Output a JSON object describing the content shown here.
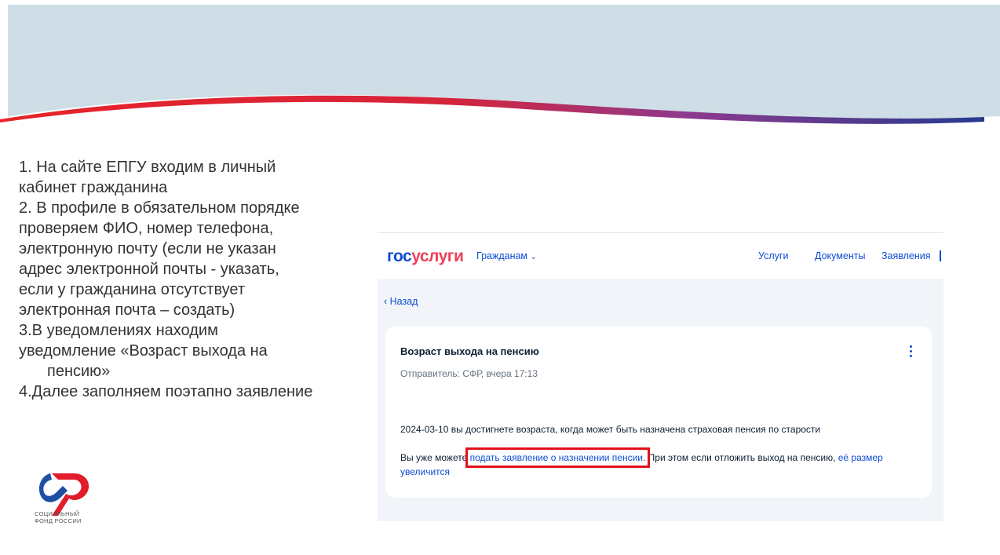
{
  "colors": {
    "header_band": "#cfdde6",
    "wave_red": "#e8232a",
    "wave_purple": "#8e3a8d",
    "wave_blue": "#253b8f",
    "gosuslugi_blue": "#0d4cd3",
    "gosuslugi_red": "#ee3f58",
    "highlight": "#e1111a"
  },
  "steps": [
    "1. На сайте ЕПГУ входим в личный\nкабинет гражданина",
    "2. В профиле в обязательном порядке\nпроверяем ФИО, номер телефона,\nэлектронную почту (если не указан\nадрес электронной почты - указать,\nесли у гражданина отсутствует\nэлектронная почта – создать)",
    "3.В уведомлениях находим\nуведомление «Возраст выхода на",
    "пенсию»",
    "4.Далее заполняем поэтапно заявление"
  ],
  "logo": {
    "icon": "sfr-logo-icon",
    "line1": "СОЦИАЛЬНЫЙ",
    "line2": "ФОНД РОССИИ"
  },
  "screenshot": {
    "brand_part1": "гос",
    "brand_part2": "услуги",
    "citizens_menu": "Гражданам",
    "citizens_icon": "chevron-down-icon",
    "nav": [
      "Услуги",
      "Документы",
      "Заявления"
    ],
    "back_label": "‹ Назад",
    "card": {
      "title": "Возраст выхода на пенсию",
      "sender": "Отправитель: СФР, вчера 17:13",
      "menu_icon": "kebab-menu-icon",
      "message1": "2024-03-10 вы достигнете возраста, когда может быть назначена страховая пенсия по старости",
      "message2_prefix": "Вы уже можете ",
      "message2_link": "подать заявление о назначении пенсии.",
      "message2_middle": " При этом если отложить выход на пенсию, ",
      "message2_link2": "её размер увеличится"
    }
  }
}
